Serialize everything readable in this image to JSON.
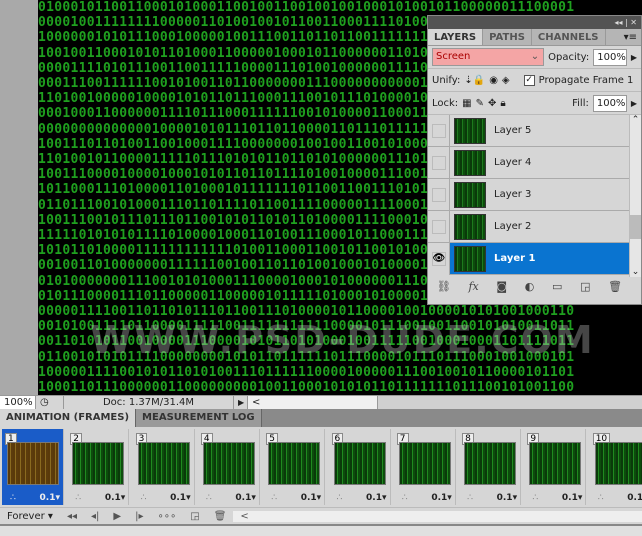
{
  "canvas": {
    "watermark": "WWW.PSD-DUDE.COM"
  },
  "layers_panel": {
    "collapse_icon": "double-chevron-icon",
    "tabs": [
      {
        "label": "LAYERS",
        "active": true
      },
      {
        "label": "PATHS"
      },
      {
        "label": "CHANNELS"
      }
    ],
    "blend_mode": "Screen",
    "opacity_label": "Opacity:",
    "opacity": "100%",
    "unify_label": "Unify:",
    "propagate_label": "Propagate Frame 1",
    "lock_label": "Lock:",
    "fill_label": "Fill:",
    "fill": "100%",
    "layers": [
      {
        "name": "Layer 5",
        "visible": false
      },
      {
        "name": "Layer 4",
        "visible": false
      },
      {
        "name": "Layer 3",
        "visible": false
      },
      {
        "name": "Layer 2",
        "visible": false
      },
      {
        "name": "Layer 1",
        "visible": true,
        "selected": true
      }
    ],
    "accent": "#0a74d0"
  },
  "status": {
    "zoom": "100%",
    "doc": "Doc: 1.37M/31.4M"
  },
  "animation": {
    "tabs": [
      {
        "label": "ANIMATION (FRAMES)",
        "active": true
      },
      {
        "label": "MEASUREMENT LOG"
      }
    ],
    "frames": [
      {
        "num": "1",
        "delay": "0.1"
      },
      {
        "num": "2",
        "delay": "0.1"
      },
      {
        "num": "3",
        "delay": "0.1"
      },
      {
        "num": "4",
        "delay": "0.1"
      },
      {
        "num": "5",
        "delay": "0.1"
      },
      {
        "num": "6",
        "delay": "0.1"
      },
      {
        "num": "7",
        "delay": "0.1"
      },
      {
        "num": "8",
        "delay": "0.1"
      },
      {
        "num": "9",
        "delay": "0.1"
      },
      {
        "num": "10",
        "delay": "0.1"
      }
    ],
    "loop": "Forever"
  }
}
